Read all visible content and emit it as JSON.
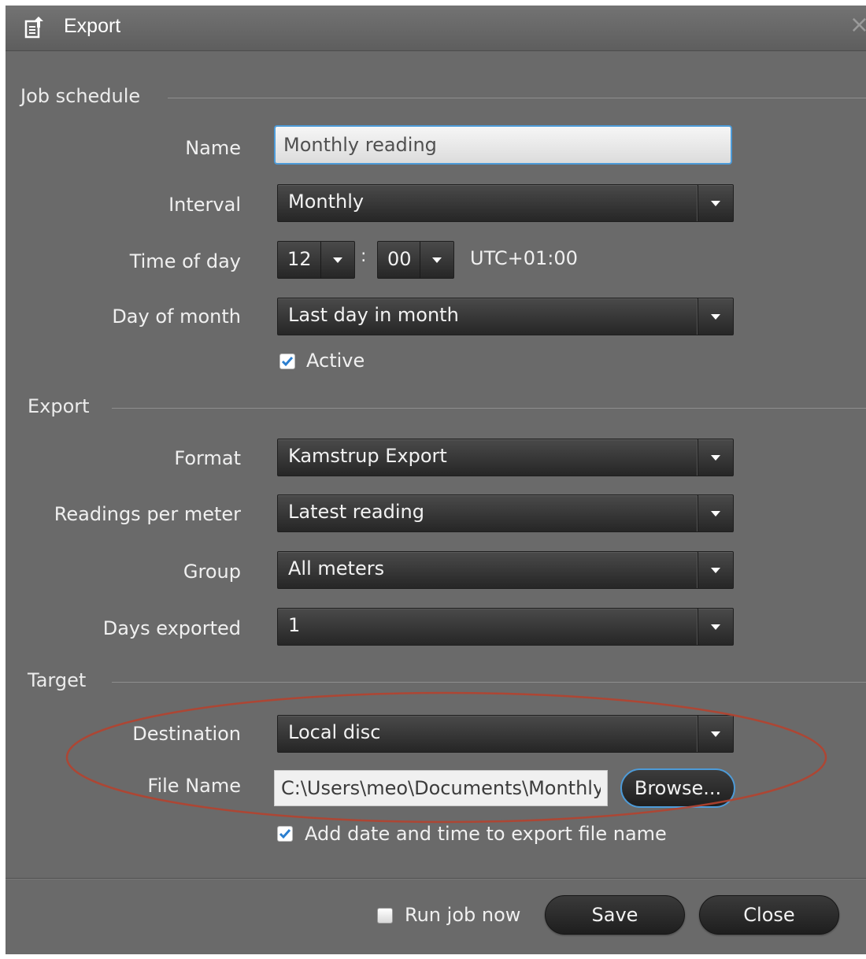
{
  "window": {
    "title": "Export",
    "icon": "export-icon"
  },
  "sections": {
    "job_schedule": "Job schedule",
    "export": "Export",
    "target": "Target"
  },
  "fields": {
    "name": {
      "label": "Name",
      "value": "Monthly reading"
    },
    "interval": {
      "label": "Interval",
      "value": "Monthly"
    },
    "time_of_day": {
      "label": "Time of day",
      "hour": "12",
      "minute": "00",
      "separator": ":",
      "timezone": "UTC+01:00"
    },
    "day_of_month": {
      "label": "Day of month",
      "value": "Last day in month"
    },
    "active": {
      "label": "Active",
      "checked": true
    },
    "format": {
      "label": "Format",
      "value": "Kamstrup Export"
    },
    "readings_per_meter": {
      "label": "Readings per meter",
      "value": "Latest reading"
    },
    "group": {
      "label": "Group",
      "value": "All meters"
    },
    "days_exported": {
      "label": "Days exported",
      "value": "1"
    },
    "destination": {
      "label": "Destination",
      "value": "Local disc"
    },
    "file_name": {
      "label": "File Name",
      "value": "C:\\Users\\meo\\Documents\\Monthly",
      "browse_label": "Browse..."
    },
    "add_datetime": {
      "label": "Add date and time to export file name",
      "checked": true
    }
  },
  "footer": {
    "run_job_now": {
      "label": "Run job now",
      "checked": false
    },
    "save_label": "Save",
    "close_label": "Close"
  },
  "colors": {
    "dialog_bg": "#6a6a6a",
    "focus_accent": "#4d9bd8",
    "highlight_ellipse": "#b5432f"
  }
}
